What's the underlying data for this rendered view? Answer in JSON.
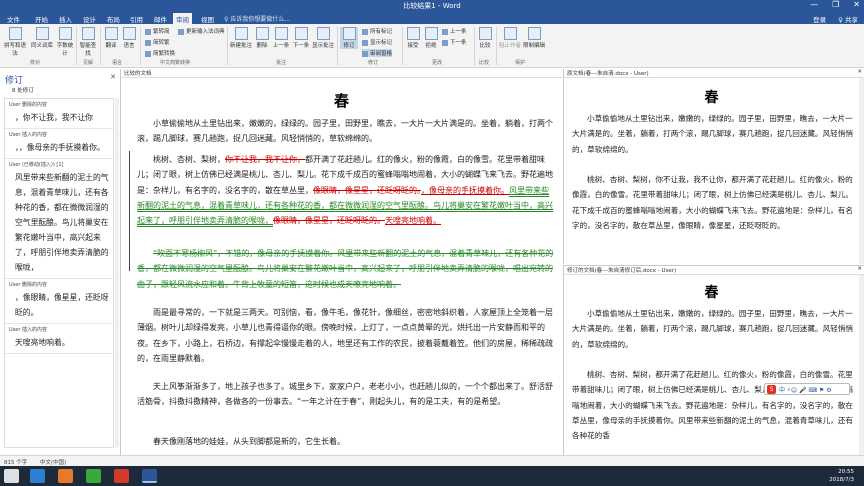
{
  "window": {
    "title": "比较结果1 - Word",
    "controls": [
      "—",
      "❐",
      "✕"
    ]
  },
  "tabs": [
    {
      "label": "文件"
    },
    {
      "label": "开始"
    },
    {
      "label": "插入"
    },
    {
      "label": "设计"
    },
    {
      "label": "布局"
    },
    {
      "label": "引用"
    },
    {
      "label": "邮件"
    },
    {
      "label": "审阅"
    },
    {
      "label": "视图"
    }
  ],
  "search_placeholder": "♀ 告诉我你想要做什么...",
  "account": {
    "login": "登录",
    "share": "♀ 共享"
  },
  "ribbon": {
    "groups": [
      "校对",
      "见解",
      "语言",
      "中文简繁转换",
      "批注",
      "修订",
      "更改",
      "比较",
      "保护"
    ],
    "buttons": {
      "spelling": "拼写和语法",
      "thesaurus": "同义词库",
      "wordcount": "字数统计",
      "smartlookup": "智能查找",
      "translate": "翻译",
      "language": "语言",
      "new_comment": "新建批注",
      "delete": "删除",
      "prev": "上一条",
      "next": "下一条",
      "show_comments": "显示批注",
      "track_changes": "修订",
      "accept": "接受",
      "reject": "拒绝",
      "compare": "比较",
      "block_authors": "阻止作者",
      "restrict": "限制编辑"
    },
    "small": {
      "trad_to_simp": "繁转简",
      "simp_to_trad": "简转繁",
      "conversion": "简繁转换",
      "ink": "墨迹批注",
      "all_markup": "所有标记",
      "show_markup": "显示标记",
      "review_pane": "审阅窗格",
      "prev_change": "上一条",
      "next_change": "下一条",
      "update_ime": "更新输入法词典"
    }
  },
  "left_pane": {
    "title": "修订",
    "count": "8 处修订",
    "items": [
      {
        "header": "User 删除的内容",
        "body": "，你不让我，我不让你"
      },
      {
        "header": "User 插入的内容",
        "body": "，，像母亲的手抚摸着你。"
      },
      {
        "header": "User (已移动(插入)) [1]",
        "body": "风里带来些新翻的泥土的气息，混着青草味儿，还有各种花的香，都在微微润湿的空气里酝酿。鸟儿将巢安在繁花嫩叶当中，高兴起来了，呼朋引伴地卖弄清脆的喉咙，"
      },
      {
        "header": "User 删除的内容",
        "body": "，像眼睛，像星星，还眨呀眨的。"
      },
      {
        "header": "User 插入的内容",
        "body": "天嗖亮地响着。"
      }
    ]
  },
  "center": {
    "header": "比较的文档",
    "title": "春",
    "paragraphs": [
      {
        "parts": [
          {
            "t": "小草偷偷地从土里钻出来，嫩嫩的，绿绿的。园子里，田野里，瞧去，一大片一大片满是的。坐着，躺着，打两个滚，踢几脚球，赛几趟跑，捉几回迷藏。风轻悄悄的，草软绵绵的。",
            "s": ""
          }
        ]
      },
      {
        "parts": [
          {
            "t": "桃树、杏树、梨树，",
            "s": ""
          },
          {
            "t": "你不让我，我不让你，",
            "s": "del"
          },
          {
            "t": "都开满了花赶趟儿。红的像火，粉的像霞，白的像雪。花里带着甜味儿；闭了眼，树上仿佛已经满是桃儿、杏儿、梨儿。花下成千成百的蜜蜂嗡嗡地闹着，大小的蝴蝶飞来飞去。野花遍地是：杂样儿，有名字的，没名字的，散在草丛里，",
            "s": ""
          },
          {
            "t": "像眼睛，像星星，还眨呀眨的。",
            "s": "del"
          },
          {
            "t": "，像母亲的手抚摸着你。",
            "s": "ins"
          },
          {
            "t": "风里带来些新翻的泥土的气息，混着青草味儿，还有各种花的香，都在微微润湿的空气里酝酿。鸟儿将巢安在繁花嫩叶当中，高兴起来了，呼朋引伴地卖弄清脆的喉咙，",
            "s": "mv"
          },
          {
            "t": "像眼睛，像星星，还眨呀眨的。",
            "s": "del"
          },
          {
            "t": "天嗖亮地响着。",
            "s": "ins"
          }
        ]
      },
      {
        "parts": [
          {
            "t": "“吹面不寒杨柳风”，不错的，像母亲的手抚摸着你。风里带来些新翻的泥土的气息，混着青草味儿，还有各种花的香，都在微微润湿的空气里酝酿。鸟儿将巢安在繁花嫩叶当中，高兴起来了，呼朋引伴地卖弄清脆的喉咙，唱出宛转的曲子，跟轻风流水应和着。牛背上牧童的短笛，这时候也成天嘹亮地响着。",
            "s": "mvdel"
          }
        ]
      },
      {
        "parts": [
          {
            "t": "雨是最寻常的，一下就是三两天。可别恼，看，像牛毛，像花针，像细丝，密密地斜织着，人家屋顶上全笼着一层薄烟。树叶儿却绿得发亮，小草儿也青得逼你的眼。傍晚时候，上灯了，一点点黄晕的光，烘托出一片安静而和平的夜。在乡下，小路上，石桥边，有撑起伞慢慢走着的人，地里还有工作的农民，披着蓑戴着笠。他们的房屋，稀稀疏疏的，在雨里静默着。",
            "s": ""
          }
        ]
      },
      {
        "parts": [
          {
            "t": "天上风筝渐渐多了，地上孩子也多了。城里乡下，家家户户，老老小小，也赶趟儿似的，一个个都出来了。舒活舒活筋骨，抖擞抖擞精神，各做各的一份事去。“一年之计在于春”，刚起头儿，有的是工夫，有的是希望。",
            "s": ""
          }
        ]
      },
      {
        "parts": [
          {
            "t": "春天像刚落地的娃娃，从头到脚都是新的，它生长着。",
            "s": ""
          }
        ]
      }
    ]
  },
  "right_top": {
    "header": "原文档(春---朱自清.docx - User)",
    "title": "春",
    "paragraphs": [
      "小草偷偷地从土里钻出来，嫩嫩的，绿绿的。园子里，田野里，瞧去，一大片一大片满是的。坐着，躺着，打两个滚，踢几脚球，赛几趟跑，捉几回迷藏。风轻悄悄的，草软绵绵的。",
      "桃树、杏树、梨树，你不让我，我不让你，都开满了花赶趟儿。红的像火，粉的像霞，白的像雪。花里带着甜味儿；闭了眼，树上仿佛已经满是桃儿、杏儿、梨儿。花下成千成百的蜜蜂嗡嗡地闹着，大小的蝴蝶飞来飞去。野花遍地是：杂样儿，有名字的，没名字的，散在草丛里，像眼睛，像星星，还眨呀眨的。"
    ]
  },
  "right_bottom": {
    "header": "修订的文档(春---朱自清修订后.docx - User)",
    "title": "春",
    "paragraphs": [
      "小草偷偷地从土里钻出来，嫩嫩的，绿绿的。园子里，田野里，瞧去，一大片一大片满是的。坐着，躺着，打两个滚，踢几脚球，赛几趟跑，捉几回迷藏。风轻悄悄的，草软绵绵的。",
      "桃树、杏树、梨树，都开满了花赶趟儿。红的像火，粉的像霞，白的像雪。花里带着甜味儿；闭了眼，树上仿佛已经满是桃儿、杏儿、梨儿。花下成千成百的蜜蜂嗡嗡地闹着，大小的蝴蝶飞来飞去。野花遍地是：杂样儿，有名字的，没名字的，散在草丛里，像母亲的手抚摸着你。风里带来些新翻的泥土的气息，混着青草味儿，还有各种花的香"
    ]
  },
  "status": {
    "words": "815 个字",
    "language": "中文(中国)"
  },
  "clock": {
    "time": "20:55",
    "date": "2018/7/3"
  },
  "colors": {
    "brand": "#2b579a",
    "insert": "#cc0000",
    "move": "#2a8a2a"
  }
}
